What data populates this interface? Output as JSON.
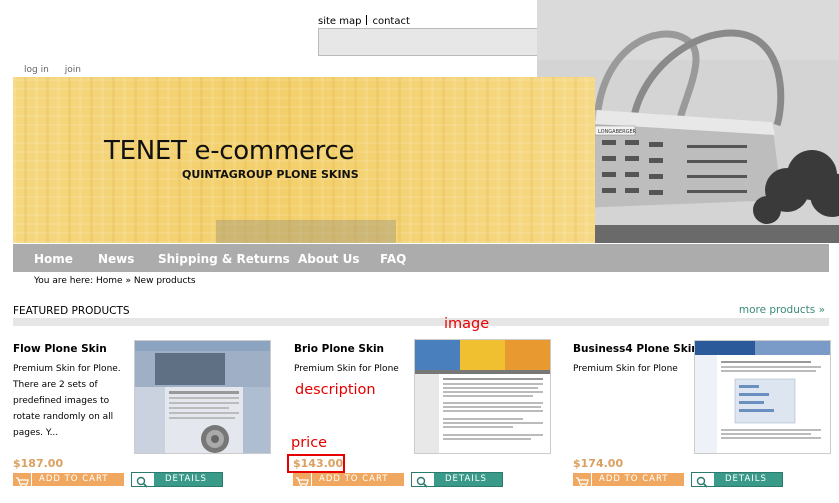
{
  "top_links": {
    "site_map": "site map",
    "contact": "contact"
  },
  "search": {
    "value": "",
    "placeholder": ""
  },
  "user_links": {
    "login": "log in",
    "join": "join"
  },
  "banner": {
    "title": "TENET e-commerce",
    "subtitle": "QUINTAGROUP PLONE SKINS",
    "photo_sign": "LONGABERGER"
  },
  "nav": [
    "Home",
    "News",
    "Shipping & Returns",
    "About Us",
    "FAQ"
  ],
  "breadcrumb": {
    "prefix": "You are here:",
    "home": "Home",
    "sep": "»",
    "current": "New products"
  },
  "featured": {
    "title": "FEATURED PRODUCTS",
    "more": "more products »"
  },
  "products": [
    {
      "name": "Flow Plone Skin",
      "description": "Premium Skin for Plone. There are 2 sets of predefined images to rotate randomly on all pages. Y...",
      "price": "$187.00",
      "cart": "ADD TO CART",
      "details": "DETAILS"
    },
    {
      "name": "Brio Plone Skin",
      "description": "Premium Skin for Plone",
      "price": "$143.00",
      "cart": "ADD TO CART",
      "details": "DETAILS"
    },
    {
      "name": "Business4 Plone Skin",
      "description": "Premium Skin for Plone",
      "price": "$174.00",
      "cart": "ADD TO CART",
      "details": "DETAILS"
    }
  ],
  "annotations": {
    "image": "image",
    "description": "description",
    "price": "price"
  },
  "colors": {
    "banner_yellow": "#f3cf6a",
    "nav_gray": "#acacac",
    "price_orange": "#d9a060",
    "cart_orange": "#f0a860",
    "details_teal": "#3a9a8a",
    "annotation_red": "#e60000"
  }
}
